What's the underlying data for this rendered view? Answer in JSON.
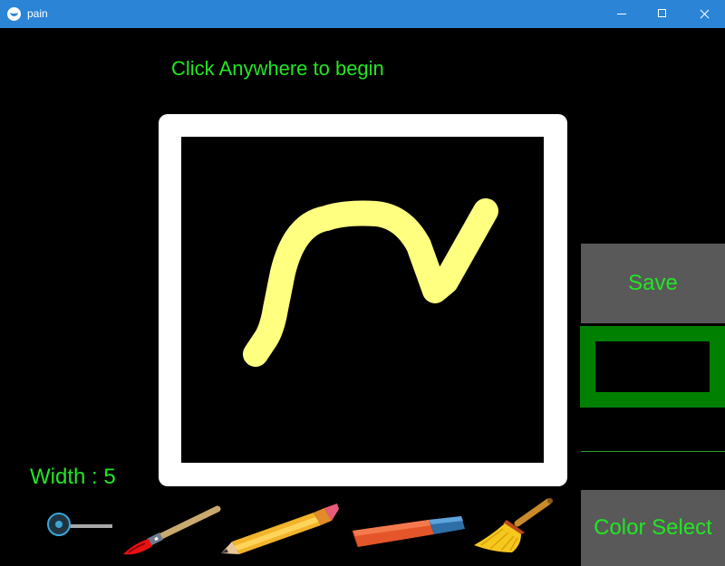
{
  "window": {
    "title": "pain"
  },
  "hint_text": "Click Anywhere to begin",
  "buttons": {
    "save": "Save",
    "color_select": "Color Select"
  },
  "brush_width_label": "Width : 5",
  "brush_width_value": 5,
  "colors": {
    "text": "#22e622",
    "current_color_frame": "#008000",
    "current_color": "#000000",
    "stroke": "#ffff80",
    "titlebar": "#2b84d6"
  },
  "tools": [
    {
      "name": "brush",
      "icon": "paintbrush-icon"
    },
    {
      "name": "pencil",
      "icon": "pencil-icon"
    },
    {
      "name": "eraser",
      "icon": "eraser-icon"
    },
    {
      "name": "broom",
      "icon": "broom-icon"
    }
  ]
}
